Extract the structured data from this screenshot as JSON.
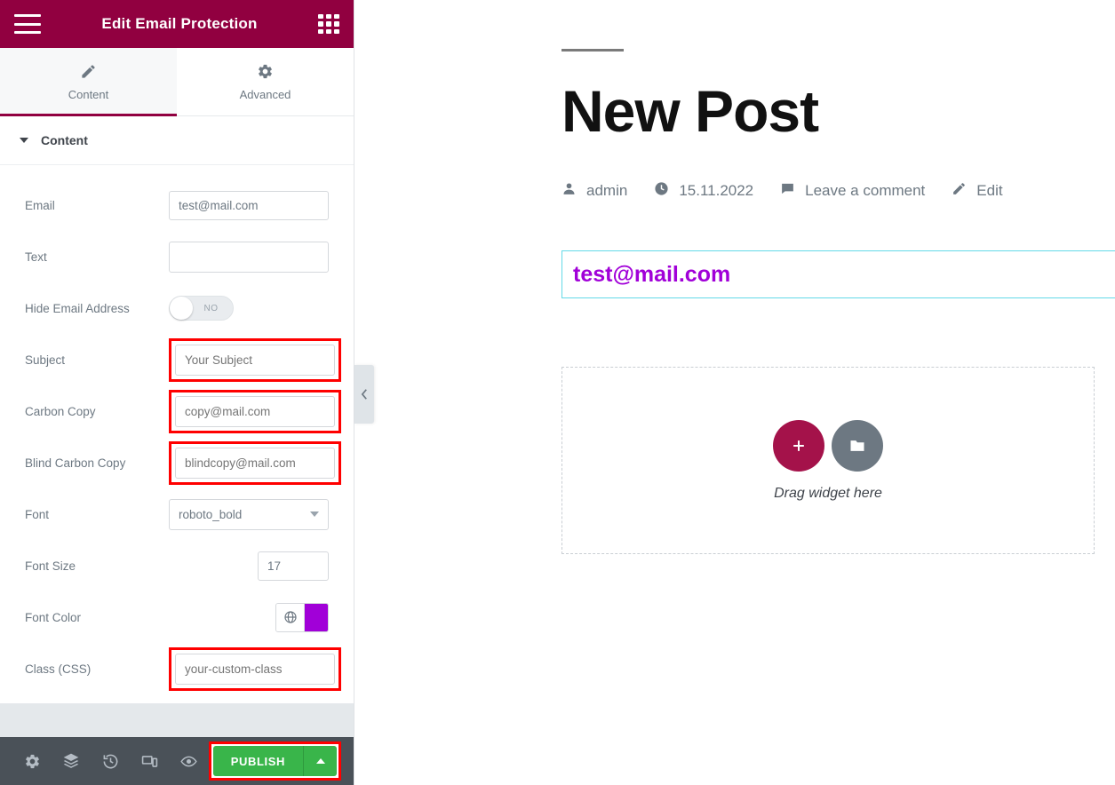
{
  "panel": {
    "header": {
      "menu_icon": "hamburger-icon",
      "title": "Edit Email Protection",
      "grid_icon": "grid-apps-icon"
    },
    "tabs": [
      {
        "label": "Content",
        "icon": "pencil-icon",
        "active": true
      },
      {
        "label": "Advanced",
        "icon": "gear-icon",
        "active": false
      }
    ],
    "section": {
      "title": "Content",
      "collapsed": false,
      "caret_icon": "caret-down-icon"
    },
    "fields": [
      {
        "label": "Email",
        "type": "text",
        "value": "test@mail.com",
        "placeholder": "",
        "highlighted": false
      },
      {
        "label": "Text",
        "type": "text",
        "value": "",
        "placeholder": "",
        "highlighted": false
      },
      {
        "label": "Hide Email Address",
        "type": "toggle",
        "value": "NO",
        "state": "off",
        "highlighted": false
      },
      {
        "label": "Subject",
        "type": "text",
        "value": "Your Subject",
        "placeholder": "Your Subject",
        "highlighted": true
      },
      {
        "label": "Carbon Copy",
        "type": "text",
        "value": "copy@mail.com",
        "placeholder": "copy@mail.com",
        "highlighted": true
      },
      {
        "label": "Blind Carbon Copy",
        "type": "text",
        "value": "blindcopy@mail.com",
        "placeholder": "blindcopy@mail.com",
        "highlighted": true
      },
      {
        "label": "Font",
        "type": "select",
        "value": "roboto_bold",
        "highlighted": false
      },
      {
        "label": "Font Size",
        "type": "number",
        "value": "17",
        "highlighted": false
      },
      {
        "label": "Font Color",
        "type": "color",
        "value": "#A100D8",
        "globe_icon": "globe-icon",
        "highlighted": false
      },
      {
        "label": "Class (CSS)",
        "type": "text",
        "value": "your-custom-class",
        "placeholder": "your-custom-class",
        "highlighted": true
      }
    ],
    "footer": {
      "icons": [
        "gear-icon",
        "layers-icon",
        "history-icon",
        "responsive-icon",
        "preview-eye-icon"
      ],
      "publish_label": "PUBLISH",
      "publish_arrow_icon": "caret-up-icon",
      "publish_highlighted": true
    },
    "collapse_handle_icon": "chevron-left-icon"
  },
  "canvas": {
    "post_title": "New Post",
    "meta": [
      {
        "icon": "person-icon",
        "label": "admin"
      },
      {
        "icon": "clock-icon",
        "label": "15.11.2022"
      },
      {
        "icon": "comment-icon",
        "label": "Leave a comment"
      },
      {
        "icon": "pencil-icon",
        "label": "Edit"
      }
    ],
    "widget": {
      "email": "test@mail.com",
      "selected": true
    },
    "dropzone": {
      "add_icon": "plus-icon",
      "folder_icon": "folder-icon",
      "text": "Drag widget here"
    }
  },
  "colors": {
    "brand": "#910040",
    "accent": "#A4124A",
    "publish_green": "#39b54a",
    "highlight_red": "#ff0000",
    "font_color_swatch": "#A100D8",
    "widget_outline": "#63d9e8"
  }
}
